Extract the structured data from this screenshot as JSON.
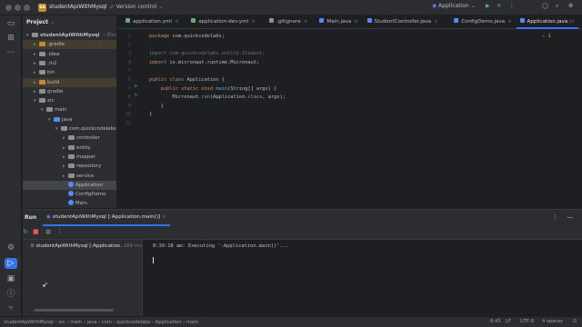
{
  "titlebar": {
    "project_badge": "SA",
    "project_name": "studentApiWithMysql",
    "vcs_label": "Version control",
    "run_config": "Application"
  },
  "project_panel": {
    "title": "Project",
    "tree": [
      {
        "label": "studentApiWithMysql",
        "suffix": "~/Downlo",
        "depth": 0,
        "arrow": "▾",
        "icon": "folder"
      },
      {
        "label": ".gradle",
        "depth": 1,
        "arrow": "▸",
        "icon": "orange",
        "highlight": true
      },
      {
        "label": ".idea",
        "depth": 1,
        "arrow": "▸",
        "icon": "folder"
      },
      {
        "label": ".m2",
        "depth": 1,
        "arrow": "▸",
        "icon": "folder"
      },
      {
        "label": "bin",
        "depth": 1,
        "arrow": "▸",
        "icon": "folder"
      },
      {
        "label": "build",
        "depth": 1,
        "arrow": "▸",
        "icon": "orange",
        "highlight": true
      },
      {
        "label": "gradle",
        "depth": 1,
        "arrow": "▸",
        "icon": "folder"
      },
      {
        "label": "src",
        "depth": 1,
        "arrow": "▾",
        "icon": "folder"
      },
      {
        "label": "main",
        "depth": 2,
        "arrow": "▾",
        "icon": "folder"
      },
      {
        "label": "java",
        "depth": 3,
        "arrow": "▾",
        "icon": "blue"
      },
      {
        "label": "com.quickcodelabs",
        "depth": 4,
        "arrow": "▾",
        "icon": "folder"
      },
      {
        "label": "controller",
        "depth": 5,
        "arrow": "▸",
        "icon": "folder"
      },
      {
        "label": "entity",
        "depth": 5,
        "arrow": "▸",
        "icon": "folder"
      },
      {
        "label": "mapper",
        "depth": 5,
        "arrow": "▸",
        "icon": "folder"
      },
      {
        "label": "repository",
        "depth": 5,
        "arrow": "▸",
        "icon": "folder"
      },
      {
        "label": "service",
        "depth": 5,
        "arrow": "▸",
        "icon": "folder"
      },
      {
        "label": "Application",
        "depth": 5,
        "arrow": "",
        "icon": "cls",
        "selected": true
      },
      {
        "label": "ConfigDemo",
        "depth": 5,
        "arrow": "",
        "icon": "cls"
      },
      {
        "label": "Main",
        "depth": 5,
        "arrow": "",
        "icon": "cls"
      }
    ]
  },
  "tabs": [
    {
      "label": "application.yml",
      "color": "#6aab73"
    },
    {
      "label": "application-dev.yml",
      "color": "#6aab73"
    },
    {
      "label": ".gitignore",
      "color": "#8c8f94"
    },
    {
      "label": "Main.java",
      "color": "#548af7"
    },
    {
      "label": "StudentController.java",
      "color": "#548af7"
    },
    {
      "label": "ConfigDemo.java",
      "color": "#548af7"
    },
    {
      "label": "Application.java",
      "color": "#548af7",
      "active": true
    }
  ],
  "editor": {
    "line_numbers": [
      "1",
      "2",
      "3",
      "4",
      "5",
      "6",
      "7",
      "8",
      "9",
      "10",
      "11"
    ],
    "lines": [
      [
        {
          "t": "package ",
          "c": "kw"
        },
        {
          "t": "com.quickcodelabs;",
          "c": ""
        }
      ],
      [],
      [
        {
          "t": "import com.quickcodelabs.entity.Student;",
          "c": "cm"
        }
      ],
      [
        {
          "t": "import ",
          "c": "kw"
        },
        {
          "t": "io.micronaut.runtime.Micronaut;",
          "c": ""
        }
      ],
      [],
      [
        {
          "t": "public class ",
          "c": "kw"
        },
        {
          "t": "Application {",
          "c": ""
        }
      ],
      [
        {
          "t": "    public static void ",
          "c": "kw"
        },
        {
          "t": "main",
          "c": "fn"
        },
        {
          "t": "(String[] args) {",
          "c": ""
        }
      ],
      [
        {
          "t": "        Micronaut.",
          "c": ""
        },
        {
          "t": "run",
          "c": "fn"
        },
        {
          "t": "(Application.",
          "c": ""
        },
        {
          "t": "class",
          "c": "kw"
        },
        {
          "t": ", args);",
          "c": ""
        }
      ],
      [
        {
          "t": "    }",
          "c": ""
        }
      ],
      [
        {
          "t": "}",
          "c": ""
        }
      ],
      []
    ],
    "warning_count": "1"
  },
  "run_window": {
    "title": "Run",
    "tab_label": "studentApiWithMysql [:Application.main()]",
    "tree_item": "studentApiWithMysql [:Application.",
    "tree_item_time": "284 ms",
    "console_text": "8:39:18 am: Executing ':Application.main()'..."
  },
  "statusbar": {
    "crumbs": [
      "studentApiWithMysql",
      "src",
      "main",
      "java",
      "com",
      "quickcodelabs",
      "Application",
      "main"
    ],
    "position": "8:45",
    "line_sep": "LF",
    "encoding": "UTF-8",
    "indent": "4 spaces"
  }
}
